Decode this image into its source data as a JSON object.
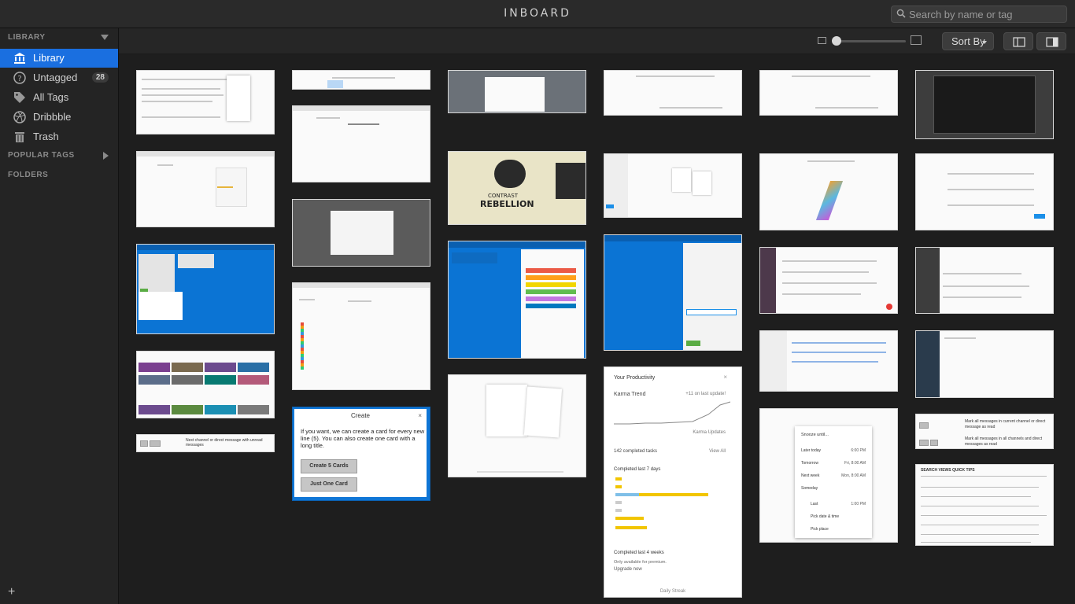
{
  "app": {
    "title": "INBOARD"
  },
  "search": {
    "placeholder": "Search by name or tag"
  },
  "sidebar": {
    "library_header": "LIBRARY",
    "items": [
      {
        "label": "Library",
        "icon": "library-icon",
        "active": true
      },
      {
        "label": "Untagged",
        "icon": "question-icon",
        "count": "28"
      },
      {
        "label": "All Tags",
        "icon": "tag-icon"
      },
      {
        "label": "Dribbble",
        "icon": "dribbble-icon"
      },
      {
        "label": "Trash",
        "icon": "trash-icon"
      }
    ],
    "popular_tags_header": "POPULAR TAGS",
    "folders_header": "FOLDERS",
    "add_label": "+"
  },
  "toolbar": {
    "sort_label": "Sort By"
  },
  "tiles": {
    "create": {
      "title": "Create",
      "close": "×",
      "body": "If you want, we can create a card for every new line (5). You can also create one card with a long title.",
      "btn_five": "Create 5 Cards",
      "btn_one": "Just One Card"
    },
    "productivity": {
      "title": "Your Productivity",
      "close": "×",
      "karma_trend": "Karma Trend",
      "karma_value": "+11 on last update!",
      "karma_updates": "Karma Updates",
      "completed_tasks": "142 completed tasks",
      "view_all": "View All",
      "last7": "Completed last 7 days",
      "last4": "Completed last 4 weeks",
      "premium": "Only available for premium.",
      "upgrade": "Upgrade now",
      "daily_streak": "Daily Streak"
    },
    "snooze": {
      "title": "Snooze until...",
      "options": [
        {
          "label": "Later today",
          "time": "6:00 PM"
        },
        {
          "label": "Tomorrow",
          "time": "Fri, 8:00 AM"
        },
        {
          "label": "Next week",
          "time": "Mon, 8:00 AM"
        },
        {
          "label": "Someday",
          "time": ""
        }
      ],
      "last_label": "Last",
      "last_time": "1:00 PM",
      "pick_date": "Pick date & time",
      "pick_place": "Pick place"
    },
    "rebellion": {
      "line1": "CONTRAST",
      "line2": "REBELLION"
    },
    "shortcut_bar": "Next channel or direct message with unread messages",
    "mark_read_1": "Mark all messages in current channel or direct message as read",
    "mark_read_2": "Mark all messages in all channels and direct messages as read",
    "search_tips": "SEARCH VIEWS QUICK TIPS"
  },
  "colors": {
    "accent": "#1a6fe0",
    "trello_blue": "#0b74d4"
  }
}
